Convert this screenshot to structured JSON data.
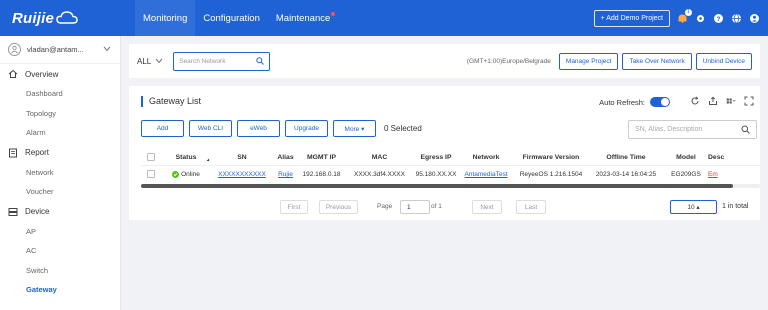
{
  "topbar": {
    "logo": "Ruijie",
    "nav": [
      {
        "label": "Monitoring",
        "active": true
      },
      {
        "label": "Configuration",
        "active": false
      },
      {
        "label": "Maintenance",
        "active": false
      }
    ],
    "add_demo_label": "+ Add Demo Project",
    "notification_count": "1"
  },
  "sidebar": {
    "user": "vladan@antam...",
    "groups": [
      {
        "label": "Overview",
        "icon": "home-icon",
        "items": [
          "Dashboard",
          "Topology",
          "Alarm"
        ]
      },
      {
        "label": "Report",
        "icon": "report-icon",
        "items": [
          "Network",
          "Voucher"
        ]
      },
      {
        "label": "Device",
        "icon": "device-icon",
        "items": [
          "AP",
          "AC",
          "Switch",
          "Gateway"
        ]
      }
    ],
    "active_item": "Gateway"
  },
  "toolbar": {
    "all_label": "ALL",
    "search_placeholder": "Search Network",
    "timezone": "(GMT+1:00)Europe/Belgrade",
    "manage_project": "Manage Project",
    "take_over_network": "Take Over Network",
    "unbind_device": "Unbind Device"
  },
  "gateway_list": {
    "title": "Gateway List",
    "auto_refresh_label": "Auto Refresh:",
    "auto_refresh_on": true,
    "actions": [
      "Add",
      "Web CLI",
      "eWeb",
      "Upgrade",
      "More ▾"
    ],
    "selected_count": "0 Selected",
    "search_placeholder": "SN, Alias, Description",
    "columns": [
      "Status",
      "SN",
      "Alias",
      "MGMT IP",
      "MAC",
      "Egress IP",
      "Network",
      "Firmware Version",
      "Offline Time",
      "Model",
      "Desc"
    ],
    "rows": [
      {
        "status": "Online",
        "sn": "XXXXXXXXXXX",
        "alias": "Rujie",
        "mgmt_ip": "192.168.0.18",
        "mac": "XXXX.3df4.XXXX",
        "egress_ip": "95.180.XX.XX",
        "network": "AntamediaTest",
        "firmware": "ReyeeOS 1.216.1504",
        "offline_time": "2023-03-14 16:04:25",
        "model": "EG209GS",
        "desc": "Em"
      }
    ],
    "pagination": {
      "first": "First",
      "previous": "Previous",
      "page_label": "Page",
      "page_value": "1",
      "of_label": "of 1",
      "next": "Next",
      "last": "Last",
      "page_size": "10 ▴",
      "total": "1 in total"
    }
  }
}
